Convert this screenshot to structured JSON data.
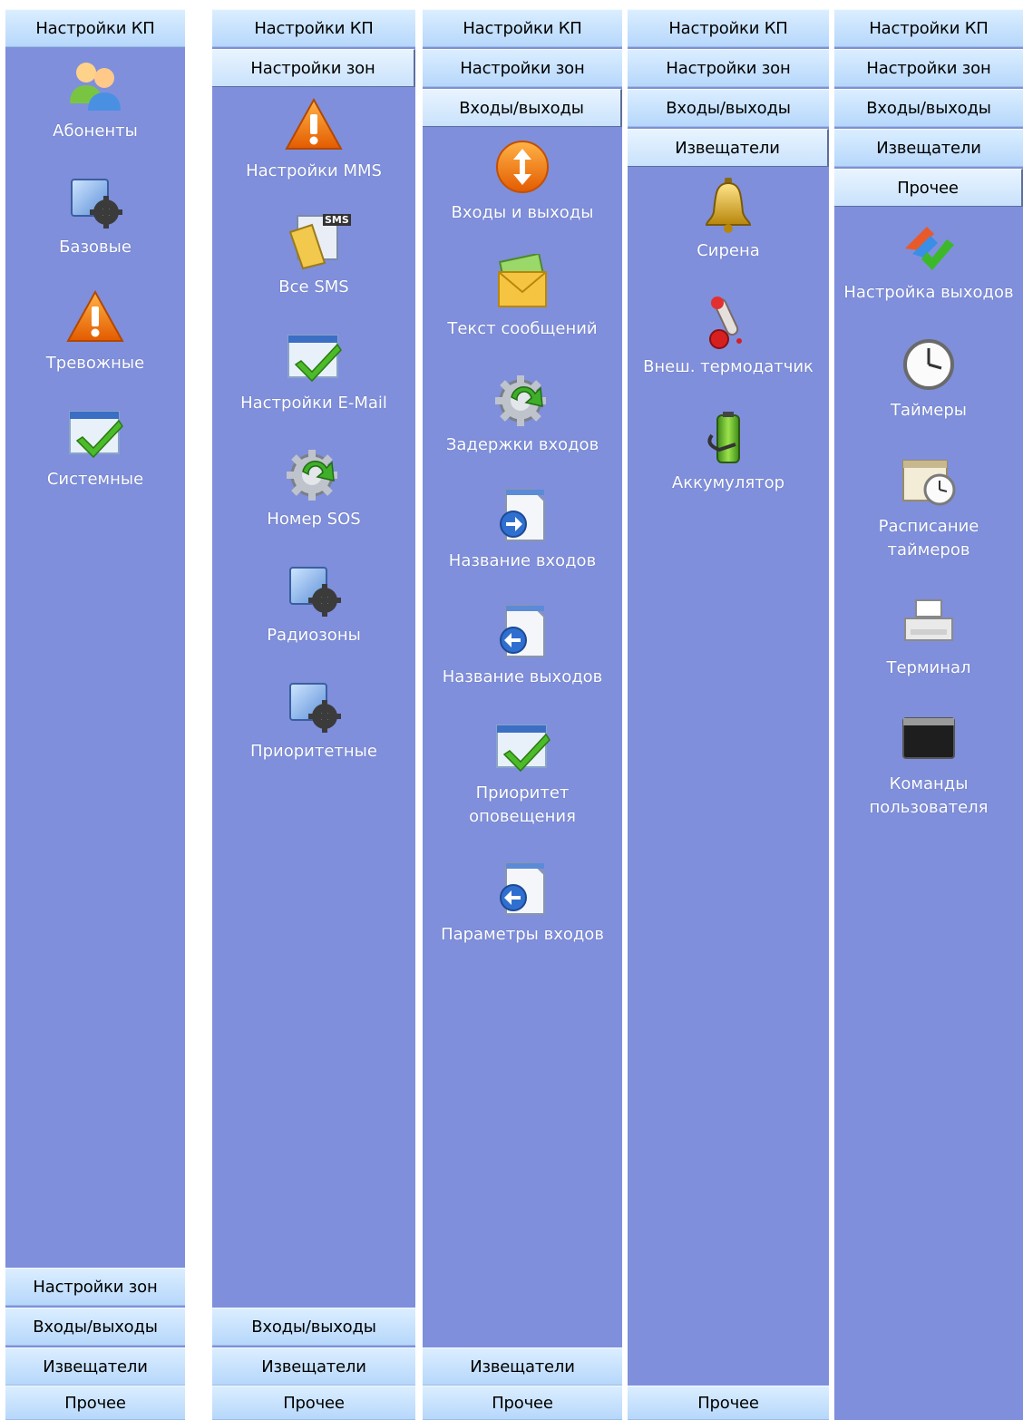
{
  "headers": {
    "kp": "Настройки КП",
    "zones": "Настройки зон",
    "io": "Входы/выходы",
    "detectors": "Извещатели",
    "other": "Прочее"
  },
  "panel1": {
    "items": [
      "Абоненты",
      "Базовые",
      "Тревожные",
      "Системные"
    ]
  },
  "panel2": {
    "items": [
      "Настройки MMS",
      "Все SMS",
      "Настройки E-Mail",
      "Номер SOS",
      "Радиозоны",
      "Приоритетные"
    ],
    "sms_badge": "SMS"
  },
  "panel3": {
    "items": [
      "Входы и выходы",
      "Текст сообщений",
      "Задержки входов",
      "Название входов",
      "Название выходов",
      "Приоритет оповещения",
      "Параметры входов"
    ]
  },
  "panel4": {
    "items": [
      "Сирена",
      "Внеш. термодатчик",
      "Аккумулятор"
    ]
  },
  "panel5": {
    "items": [
      "Настройка выходов",
      "Таймеры",
      "Расписание таймеров",
      "Терминал",
      "Команды пользователя"
    ]
  },
  "colors": {
    "panel_bg": "#7f8fdc",
    "header_bg": "#c4e0fd",
    "label_text": "#ffffff"
  }
}
